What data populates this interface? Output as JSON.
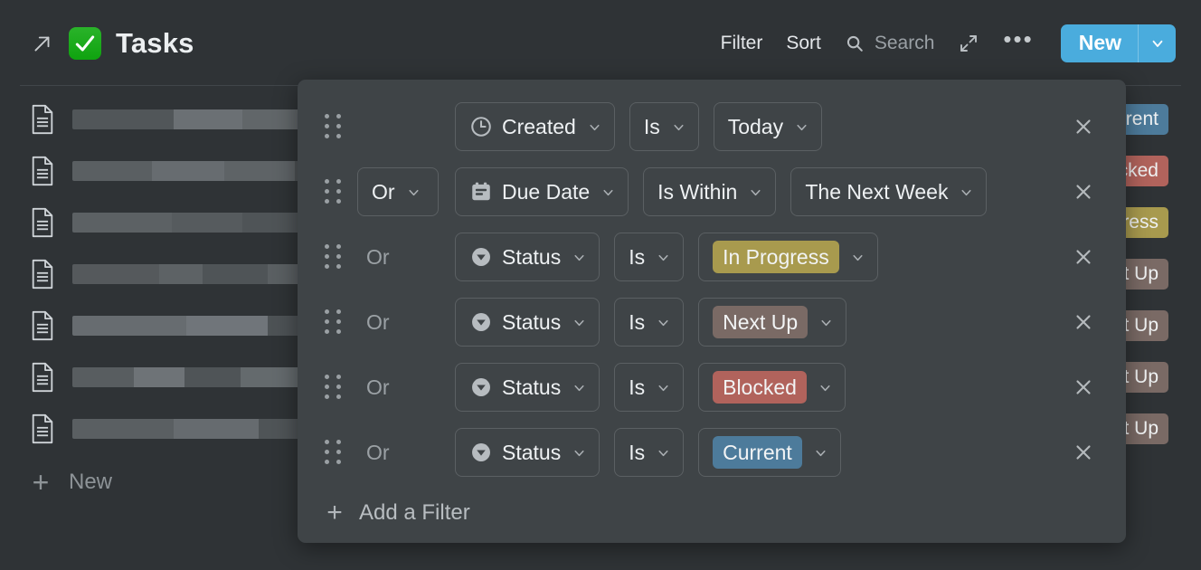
{
  "header": {
    "open_arrow_icon": "open-in-new-arrow-icon",
    "app_emoji": "white-heavy-check-mark-emoji",
    "title": "Tasks",
    "filter_label": "Filter",
    "sort_label": "Sort",
    "search_icon": "search-icon",
    "search_placeholder": "Search",
    "expand_icon": "expand-diagonal-icon",
    "more_label": "•••",
    "new_label": "New",
    "new_caret_icon": "chevron-down-icon",
    "new_button_color": "#4aacdd"
  },
  "list": {
    "rows": [
      {
        "icon": "document-icon",
        "status": "Current",
        "status_color": "#4d7b9b",
        "redact": [
          [
            112,
            "#515659"
          ],
          [
            76,
            "#6b7074"
          ],
          [
            84,
            "#616669"
          ],
          [
            80,
            "#4e5356"
          ],
          [
            84,
            "#70757a"
          ],
          [
            74,
            "#62676a"
          ],
          [
            70,
            "#585d60"
          ],
          [
            86,
            "#6d7276"
          ],
          [
            74,
            "#4f5457"
          ],
          [
            96,
            "#696e72"
          ]
        ]
      },
      {
        "icon": "document-icon",
        "status": "Blocked",
        "status_color": "#b1635c",
        "redact": [
          [
            88,
            "#5a5f62"
          ],
          [
            80,
            "#676c70"
          ],
          [
            78,
            "#5e6366"
          ],
          [
            92,
            "#4e5356"
          ],
          [
            70,
            "#747a7e"
          ],
          [
            62,
            "#5c6164"
          ],
          [
            92,
            "#53585b"
          ],
          [
            78,
            "#6b7074"
          ],
          [
            80,
            "#4f5457"
          ],
          [
            88,
            "#646a6d"
          ]
        ]
      },
      {
        "icon": "document-icon",
        "status": "In Progress",
        "status_color": "#a89a4e",
        "redact": [
          [
            110,
            "#5c6164"
          ],
          [
            78,
            "#565b5e"
          ],
          [
            100,
            "#4f5457"
          ],
          [
            96,
            "#71767a"
          ],
          [
            72,
            "#5a5f62"
          ],
          [
            86,
            "#676c70"
          ],
          [
            90,
            "#525759"
          ],
          [
            84,
            "#6a6f73"
          ]
        ]
      },
      {
        "icon": "document-icon",
        "status": "Next Up",
        "status_color": "#7a6a65",
        "redact": [
          [
            96,
            "#55595c"
          ],
          [
            48,
            "#5d6265"
          ],
          [
            72,
            "#4f5457"
          ],
          [
            102,
            "#5a5f62"
          ],
          [
            66,
            "#6a6f73"
          ],
          [
            58,
            "#565b5e"
          ],
          [
            80,
            "#62676b"
          ],
          [
            74,
            "#4e5356"
          ],
          [
            98,
            "#686d71"
          ]
        ]
      },
      {
        "icon": "document-icon",
        "status": "Next Up",
        "status_color": "#7a6a65",
        "redact": [
          [
            126,
            "#676c70"
          ],
          [
            90,
            "#70757a"
          ],
          [
            44,
            "#4d5255"
          ],
          [
            70,
            "#5d6265"
          ],
          [
            84,
            "#656a6e"
          ],
          [
            72,
            "#52575a"
          ],
          [
            98,
            "#6b7074"
          ],
          [
            76,
            "#575c5f"
          ]
        ]
      },
      {
        "icon": "document-icon",
        "status": "Next Up",
        "status_color": "#7a6a65",
        "redact": [
          [
            68,
            "#585d60"
          ],
          [
            56,
            "#6e7377"
          ],
          [
            62,
            "#4f5457"
          ],
          [
            90,
            "#646a6d"
          ],
          [
            52,
            "#5a5f62"
          ],
          [
            78,
            "#696e72"
          ],
          [
            66,
            "#545a5c"
          ],
          [
            88,
            "#60656a"
          ],
          [
            72,
            "#4e5356"
          ]
        ]
      },
      {
        "icon": "document-icon",
        "status": "Next Up",
        "status_color": "#7a6a65",
        "redact": [
          [
            112,
            "#5a5f62"
          ],
          [
            94,
            "#666b6f"
          ],
          [
            80,
            "#4f5457"
          ],
          [
            88,
            "#6a6f73"
          ],
          [
            70,
            "#565b5e"
          ],
          [
            96,
            "#61666a"
          ]
        ]
      }
    ],
    "new_row_plus": "plus-icon",
    "new_row_label": "New"
  },
  "filter_panel": {
    "rows": [
      {
        "drag_handle_icon": "drag-handle-icon",
        "conjunction": null,
        "conjunction_boxed": false,
        "field_icon": "clock-icon",
        "field": "Created",
        "operator": "Is",
        "value": "Today",
        "value_pill_color": null,
        "remove_icon": "close-icon"
      },
      {
        "drag_handle_icon": "drag-handle-icon",
        "conjunction": "Or",
        "conjunction_boxed": true,
        "field_icon": "calendar-icon",
        "field": "Due Date",
        "operator": "Is Within",
        "value": "The Next Week",
        "value_pill_color": null,
        "remove_icon": "close-icon"
      },
      {
        "drag_handle_icon": "drag-handle-icon",
        "conjunction": "Or",
        "conjunction_boxed": false,
        "field_icon": "status-select-icon",
        "field": "Status",
        "operator": "Is",
        "value": "In Progress",
        "value_pill_color": "#a89a4e",
        "remove_icon": "close-icon"
      },
      {
        "drag_handle_icon": "drag-handle-icon",
        "conjunction": "Or",
        "conjunction_boxed": false,
        "field_icon": "status-select-icon",
        "field": "Status",
        "operator": "Is",
        "value": "Next Up",
        "value_pill_color": "#7a6a65",
        "remove_icon": "close-icon"
      },
      {
        "drag_handle_icon": "drag-handle-icon",
        "conjunction": "Or",
        "conjunction_boxed": false,
        "field_icon": "status-select-icon",
        "field": "Status",
        "operator": "Is",
        "value": "Blocked",
        "value_pill_color": "#b1635c",
        "remove_icon": "close-icon"
      },
      {
        "drag_handle_icon": "drag-handle-icon",
        "conjunction": "Or",
        "conjunction_boxed": false,
        "field_icon": "status-select-icon",
        "field": "Status",
        "operator": "Is",
        "value": "Current",
        "value_pill_color": "#4d7b9b",
        "remove_icon": "close-icon"
      }
    ],
    "add_filter_plus": "plus-icon",
    "add_filter_label": "Add a Filter"
  }
}
